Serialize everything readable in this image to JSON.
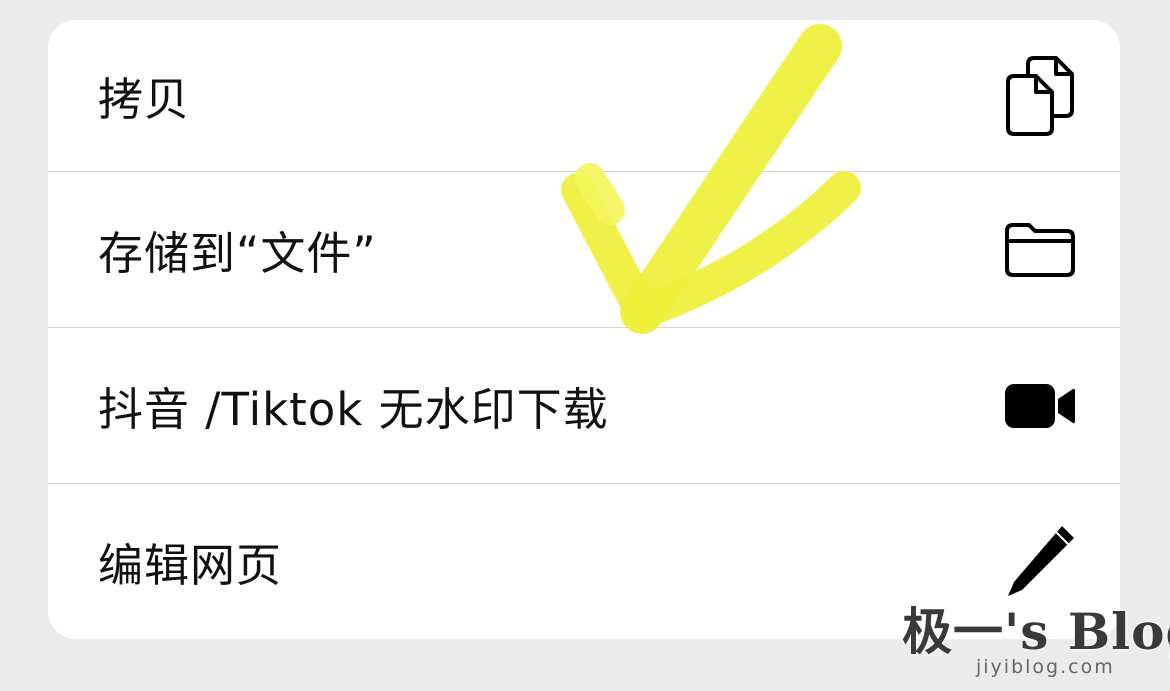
{
  "menu": {
    "items": [
      {
        "label": "拷贝",
        "icon": "copy-icon"
      },
      {
        "label": "存储到“文件”",
        "icon": "folder-icon"
      },
      {
        "label": "抖音 /Tiktok 无水印下载",
        "icon": "video-camera-icon"
      },
      {
        "label": "编辑网页",
        "icon": "pencil-icon"
      }
    ]
  },
  "overlay": {
    "mark_icon": "checkmark-icon",
    "mark_color": "#eef03a"
  },
  "watermark": {
    "title": "极一's Blog",
    "url": "jiyiblog.com"
  },
  "colors": {
    "background": "#ebebeb",
    "sheet": "#ffffff",
    "text": "#121212",
    "divider": "#d6d6d6"
  }
}
